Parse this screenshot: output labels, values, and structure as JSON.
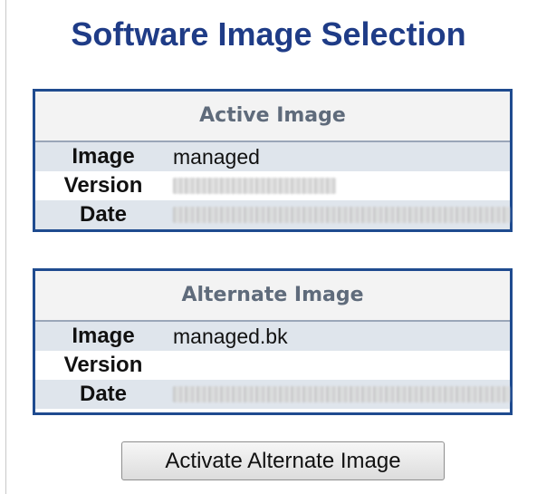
{
  "page_title": "Software Image Selection",
  "active_image": {
    "header": "Active Image",
    "rows": [
      {
        "label": "Image",
        "value": "managed"
      },
      {
        "label": "Version",
        "value": "1.4481 00023"
      },
      {
        "label": "Date",
        "value": "2018-08-23T11:40:17+08:00"
      }
    ]
  },
  "alternate_image": {
    "header": "Alternate Image",
    "rows": [
      {
        "label": "Image",
        "value": "managed.bk"
      },
      {
        "label": "Version",
        "value": ""
      },
      {
        "label": "Date",
        "value": "2018-08-05T10:00:00+08:00"
      }
    ]
  },
  "actions": {
    "activate_label": "Activate Alternate Image"
  }
}
